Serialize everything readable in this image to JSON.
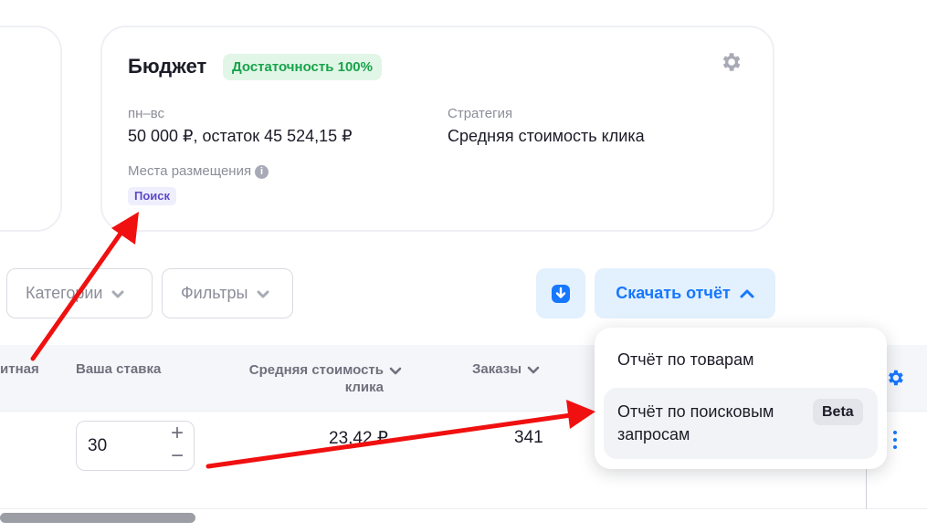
{
  "budget": {
    "title": "Бюджет",
    "sufficiency_badge": "Достаточность 100%",
    "period_label": "пн–вс",
    "amount": "50 000 ₽, остаток 45 524,15 ₽",
    "strategy_label": "Стратегия",
    "strategy_value": "Средняя стоимость клика",
    "placements_label": "Места размещения",
    "placement_tag": "Поиск",
    "info_glyph": "i",
    "icons": {
      "settings": "gear-icon",
      "info": "info-icon"
    }
  },
  "filters": {
    "categories_label": "Категории",
    "filters_label": "Фильтры"
  },
  "toolbar": {
    "download_report_label": "Скачать отчёт"
  },
  "dropdown": {
    "item_products": "Отчёт по товарам",
    "item_search_queries": "Отчёт по поисковым запросам",
    "beta_badge": "Beta"
  },
  "table": {
    "headers": {
      "partial_prev": "итная",
      "bid": "Ваша ставка",
      "avg_cpc": "Средняя стоимость клика",
      "orders": "Заказы"
    },
    "row": {
      "bid_value": "30",
      "stepper_plus": "+",
      "stepper_minus": "−",
      "avg_cpc": "23,42 ₽",
      "orders": "341"
    }
  },
  "colors": {
    "accent": "#1677ff",
    "success_bg": "#e2f6e7",
    "success_text": "#17a34a",
    "tag_bg": "#efeefd",
    "tag_text": "#5b4bc7",
    "annotation_arrow": "#f01010"
  }
}
